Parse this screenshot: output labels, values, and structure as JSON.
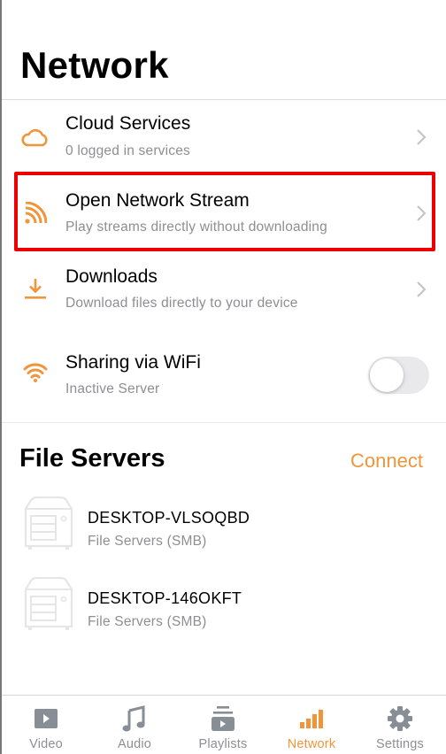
{
  "page": {
    "title": "Network"
  },
  "colors": {
    "accent": "#f0953a",
    "secondary_text": "#8e8e93",
    "inactive_icon": "#888e95",
    "highlight": "#ee0000"
  },
  "network_items": [
    {
      "icon": "cloud-icon",
      "title": "Cloud Services",
      "subtitle": "0 logged in services",
      "accessory": "chevron"
    },
    {
      "icon": "stream-icon",
      "title": "Open Network Stream",
      "subtitle": "Play streams directly without downloading",
      "accessory": "chevron",
      "highlighted": true
    },
    {
      "icon": "download-icon",
      "title": "Downloads",
      "subtitle": "Download files directly to your device",
      "accessory": "chevron"
    },
    {
      "icon": "wifi-icon",
      "title": "Sharing via WiFi",
      "subtitle": "Inactive Server",
      "accessory": "toggle",
      "toggle_on": false
    }
  ],
  "file_servers": {
    "title": "File Servers",
    "connect_label": "Connect",
    "servers": [
      {
        "icon": "server-icon",
        "name": "DESKTOP-VLSOQBD",
        "type": "File Servers (SMB)"
      },
      {
        "icon": "server-icon",
        "name": "DESKTOP-146OKFT",
        "type": "File Servers (SMB)"
      }
    ]
  },
  "tabbar": {
    "active": "Network",
    "tabs": [
      {
        "icon": "video-icon",
        "label": "Video"
      },
      {
        "icon": "music-note-icon",
        "label": "Audio"
      },
      {
        "icon": "playlist-icon",
        "label": "Playlists"
      },
      {
        "icon": "network-bars-icon",
        "label": "Network"
      },
      {
        "icon": "gear-icon",
        "label": "Settings"
      }
    ]
  }
}
